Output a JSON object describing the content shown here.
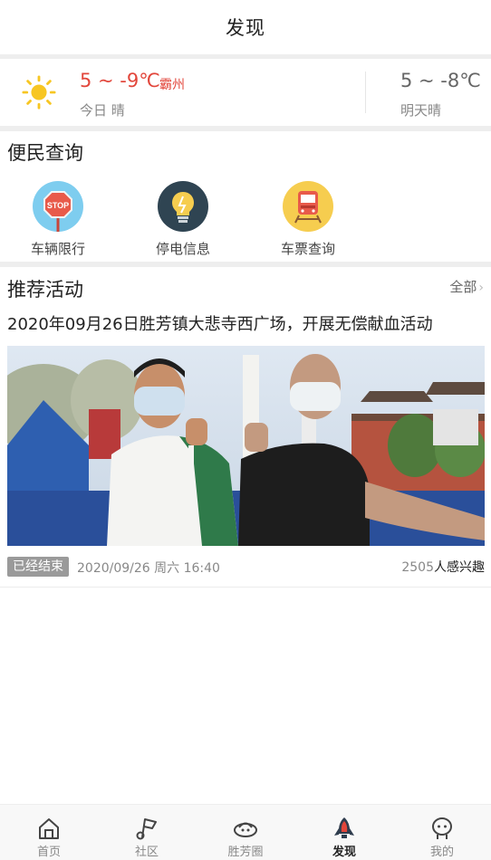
{
  "header": {
    "title": "发现"
  },
  "weather": {
    "today_temp": "5 ~ -9℃",
    "city": "霸州",
    "today_desc": "今日 晴",
    "tomorrow_temp": "5 ~ -8℃",
    "tomorrow_desc": "明天晴",
    "icon": "sun-icon"
  },
  "services": {
    "title": "便民查询",
    "items": [
      {
        "label": "车辆限行",
        "icon": "stop-sign-icon",
        "color": "#7ecdef"
      },
      {
        "label": "停电信息",
        "icon": "lightbulb-icon",
        "color": "#2f4452"
      },
      {
        "label": "车票查询",
        "icon": "train-icon",
        "color": "#f6cd4f"
      }
    ]
  },
  "activities": {
    "title": "推荐活动",
    "more_label": "全部",
    "item": {
      "title": "2020年09月26日胜芳镇大悲寺西广场，开展无偿献血活动",
      "image": "blood-donation-photo",
      "status": "已经结束",
      "datetime": "2020/09/26 周六 16:40",
      "interest_count": "2505",
      "interest_suffix": "人感兴趣"
    }
  },
  "tabbar": {
    "items": [
      {
        "label": "首页",
        "icon": "home-icon"
      },
      {
        "label": "社区",
        "icon": "flag-icon"
      },
      {
        "label": "胜芳圈",
        "icon": "planet-icon"
      },
      {
        "label": "发现",
        "icon": "rocket-icon",
        "active": true
      },
      {
        "label": "我的",
        "icon": "user-icon"
      }
    ]
  },
  "colors": {
    "accent": "#e2463b",
    "muted": "#888888",
    "badge": "#9a9a9a"
  }
}
